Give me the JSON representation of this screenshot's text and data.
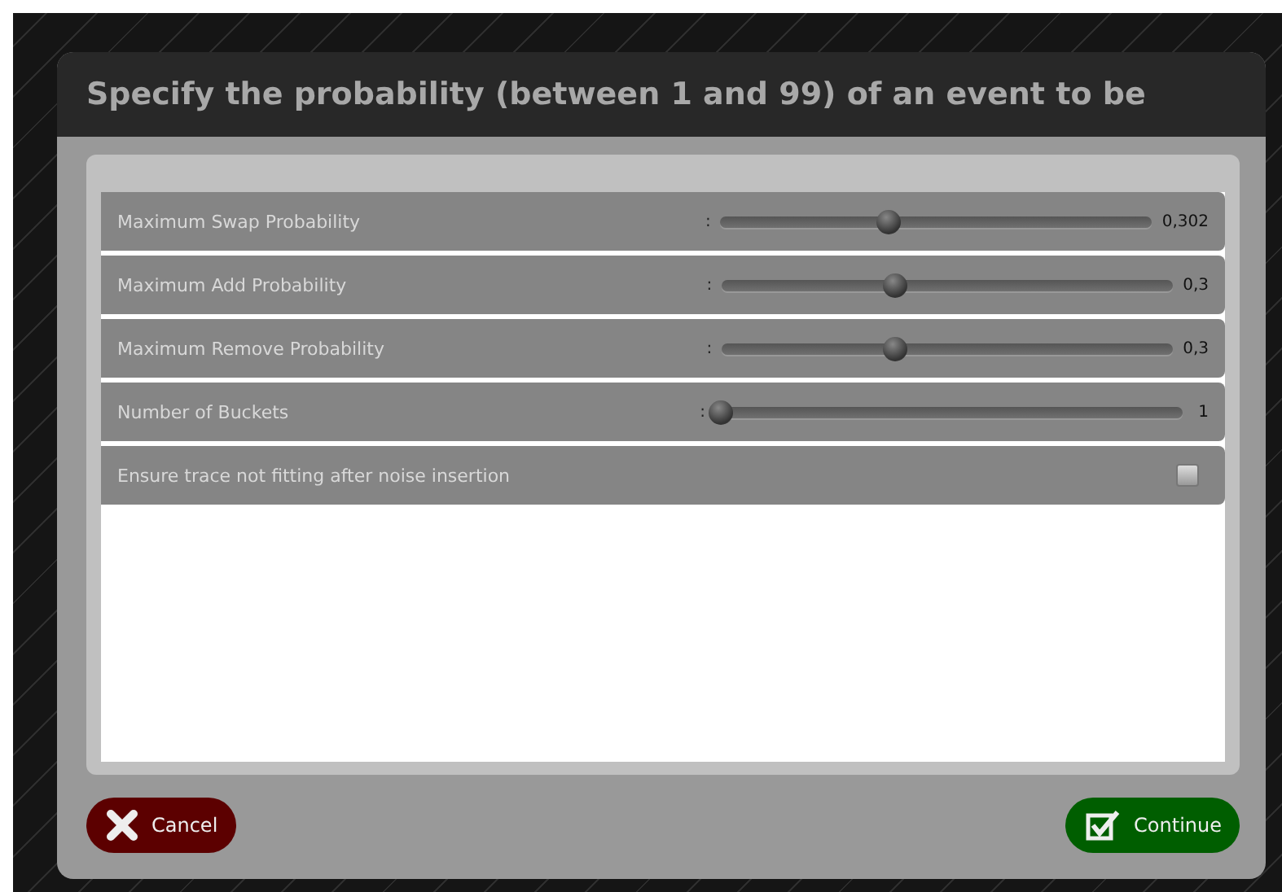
{
  "dialog": {
    "title": "Specify the probability (between 1 and 99) of an event to be"
  },
  "settings": [
    {
      "kind": "slider",
      "label": "Maximum Swap Probability",
      "separator": ":",
      "level": 0.385,
      "reading": "0,302"
    },
    {
      "kind": "slider",
      "label": "Maximum Add Probability",
      "separator": ":",
      "level": 0.38,
      "reading": "0,3"
    },
    {
      "kind": "slider",
      "label": "Maximum Remove Probability",
      "separator": ":",
      "level": 0.38,
      "reading": "0,3"
    },
    {
      "kind": "slider",
      "label": "Number of Buckets",
      "separator": ":",
      "level": 0.0,
      "reading": "1"
    },
    {
      "kind": "checkbox",
      "label": "Ensure trace not fitting after noise insertion",
      "checked": false
    }
  ],
  "buttons": [
    {
      "kind": "cancel",
      "label": "Cancel"
    },
    {
      "kind": "continue",
      "label": "Continue"
    }
  ]
}
